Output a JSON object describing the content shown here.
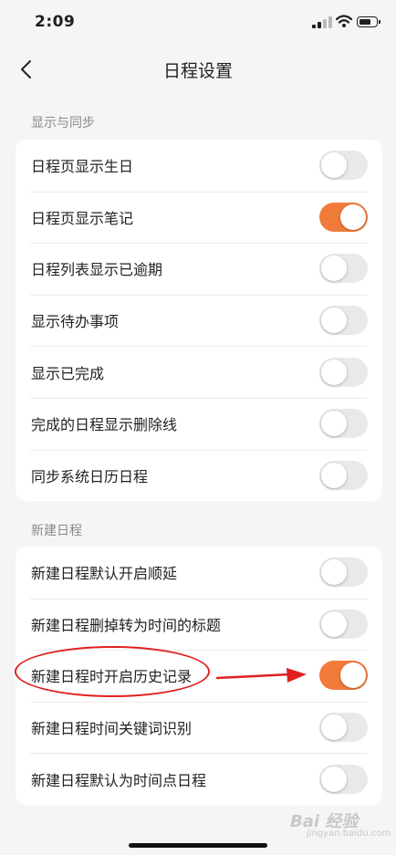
{
  "status_bar": {
    "time": "2:09"
  },
  "nav": {
    "title": "日程设置"
  },
  "sections": [
    {
      "label": "显示与同步",
      "items": [
        {
          "label": "日程页显示生日",
          "on": false
        },
        {
          "label": "日程页显示笔记",
          "on": true
        },
        {
          "label": "日程列表显示已逾期",
          "on": false
        },
        {
          "label": "显示待办事项",
          "on": false
        },
        {
          "label": "显示已完成",
          "on": false
        },
        {
          "label": "完成的日程显示删除线",
          "on": false
        },
        {
          "label": "同步系统日历日程",
          "on": false
        }
      ]
    },
    {
      "label": "新建日程",
      "items": [
        {
          "label": "新建日程默认开启顺延",
          "on": false
        },
        {
          "label": "新建日程删掉转为时间的标题",
          "on": false
        },
        {
          "label": "新建日程时开启历史记录",
          "on": true
        },
        {
          "label": "新建日程时间关键词识别",
          "on": false
        },
        {
          "label": "新建日程默认为时间点日程",
          "on": false
        }
      ]
    }
  ],
  "colors": {
    "accent": "#f07b3a",
    "toggle_off": "#e9e9eb",
    "annotation": "#e02020"
  },
  "watermark": {
    "text": "Bai 经验",
    "sub": "jingyan.baidu.com"
  }
}
